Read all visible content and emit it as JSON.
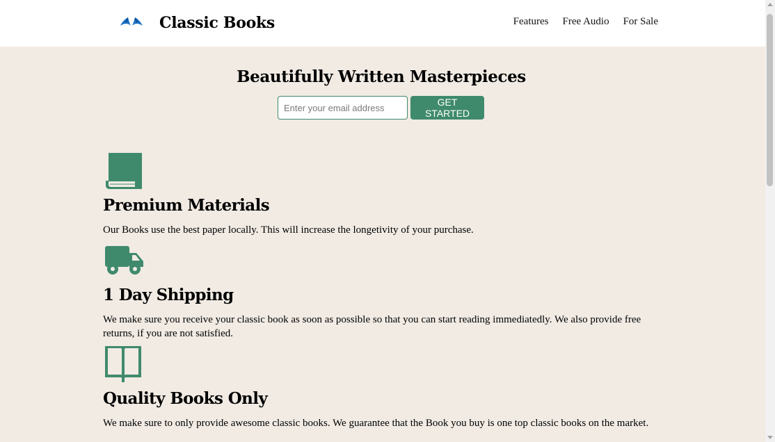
{
  "header": {
    "brand_name": "Classic Books",
    "logo_icon": "blue-wings-logo",
    "nav": [
      {
        "label": "Features"
      },
      {
        "label": "Free Audio"
      },
      {
        "label": "For Sale"
      }
    ]
  },
  "hero": {
    "title": "Beautifully Written Masterpieces",
    "email_placeholder": "Enter your email address",
    "email_value": "",
    "cta_label": "GET STARTED"
  },
  "features": [
    {
      "icon": "book-icon",
      "title": "Premium Materials",
      "text": "Our Books use the best paper locally. This will increase the longetivity of your purchase."
    },
    {
      "icon": "truck-icon",
      "title": "1 Day Shipping",
      "text": "We make sure you receive your classic book as soon as possible so that you can start reading immediatedly. We also provide free returns, if you are not satisfied."
    },
    {
      "icon": "open-book-icon",
      "title": "Quality Books Only",
      "text": "We make sure to only provide awesome classic books. We guarantee that the Book you buy is one top classic books on the market."
    }
  ],
  "colors": {
    "accent": "#3f8a6c",
    "background": "#f1ebe4",
    "header_background": "#ffffff",
    "logo_blue": "#1b6fc4"
  }
}
